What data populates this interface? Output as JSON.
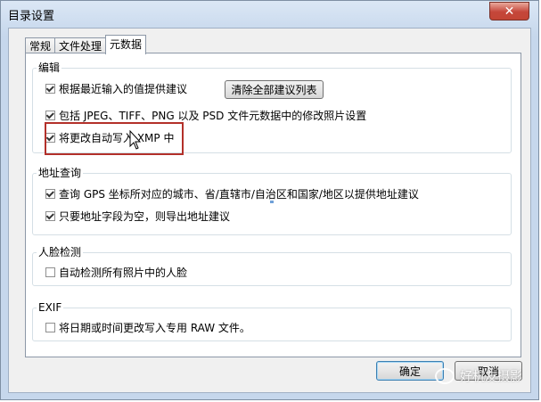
{
  "window": {
    "title": "目录设置",
    "close_label": "✕"
  },
  "tabs": [
    {
      "label": "常规",
      "active": false
    },
    {
      "label": "文件处理",
      "active": false
    },
    {
      "label": "元数据",
      "active": true
    }
  ],
  "groups": {
    "edit": {
      "title": "编辑",
      "items": [
        {
          "label": "根据最近输入的值提供建议",
          "checked": true
        },
        {
          "label": "包括 JPEG、TIFF、PNG 以及 PSD 文件元数据中的修改照片设置",
          "checked": true
        },
        {
          "label": "将更改自动写入 XMP 中",
          "checked": true
        }
      ],
      "clear_button": "清除全部建议列表"
    },
    "address": {
      "title": "地址查询",
      "items": [
        {
          "label": "查询 GPS 坐标所对应的城市、省/直辖市/自治区和国家/地区以提供地址建议",
          "checked": true
        },
        {
          "label": "只要地址字段为空，则导出地址建议",
          "checked": true
        }
      ]
    },
    "face": {
      "title": "人脸检测",
      "items": [
        {
          "label": "自动检测所有照片中的人脸",
          "checked": false
        }
      ]
    },
    "exif": {
      "title": "EXIF",
      "items": [
        {
          "label": "将日期或时间更改写入专用 RAW 文件。",
          "checked": false
        }
      ]
    }
  },
  "buttons": {
    "ok": "确定",
    "cancel": "取消"
  },
  "watermark": "好机友摄影",
  "colors": {
    "highlight_border": "#b3302a",
    "title_bar": "#c6d7ec"
  }
}
